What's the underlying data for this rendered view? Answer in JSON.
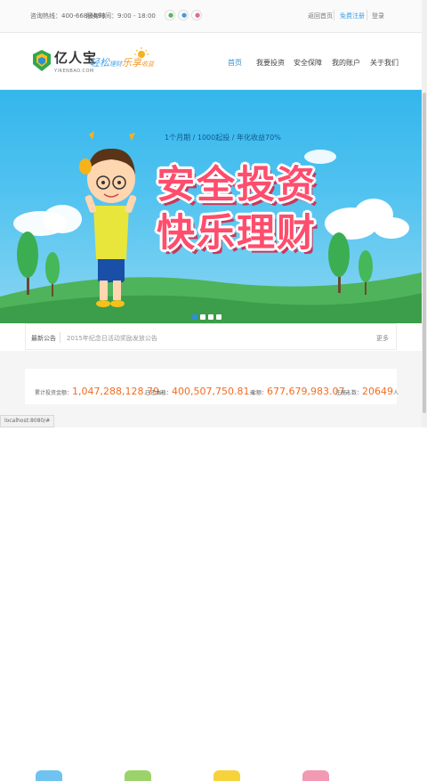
{
  "topbar": {
    "phone": "咨询热线：400-668-6698",
    "hours": "服务时间：9:00 - 18:00",
    "social_icons": [
      "wechat-icon",
      "weibo-icon",
      "qq-icon"
    ],
    "back_home": "返回首页",
    "register": "免费注册",
    "login": "登录"
  },
  "header": {
    "logo_name": "亿人宝",
    "logo_sub": "YIRENBAO.COM",
    "slogan": {
      "part1": "轻松",
      "part2": "理财",
      "part3": "乐享",
      "part4": "收益"
    },
    "nav": [
      "首页",
      "我要投资",
      "安全保障",
      "我的账户",
      "关于我们"
    ],
    "active_nav": "首页"
  },
  "banner": {
    "tagline": "1个月期 / 1000起投 / 年化收益70%",
    "title_line1": "安全投资",
    "title_line2": "快乐理财",
    "slides": 4,
    "active_slide": 1
  },
  "notice": {
    "label": "最新公告",
    "text": "2015年纪念日活动奖励发放公告",
    "more": "更多"
  },
  "stats": [
    {
      "label": "累计投资金额：",
      "value": "1,047,288,128.79",
      "unit": "元"
    },
    {
      "label": "已还本息：",
      "value": "400,507,750.81",
      "unit": "元"
    },
    {
      "label": "余额：",
      "value": "677,679,983.07",
      "unit": "元"
    },
    {
      "label": "注册人数：",
      "value": "20649",
      "unit": "人"
    }
  ],
  "status_bar": {
    "url": "localhost:8080/#"
  },
  "colors": {
    "accent": "#2f8fd8",
    "stat_number": "#f36c21",
    "banner_sky": "#34b6ec",
    "title_pink": "#ff4d6d"
  }
}
